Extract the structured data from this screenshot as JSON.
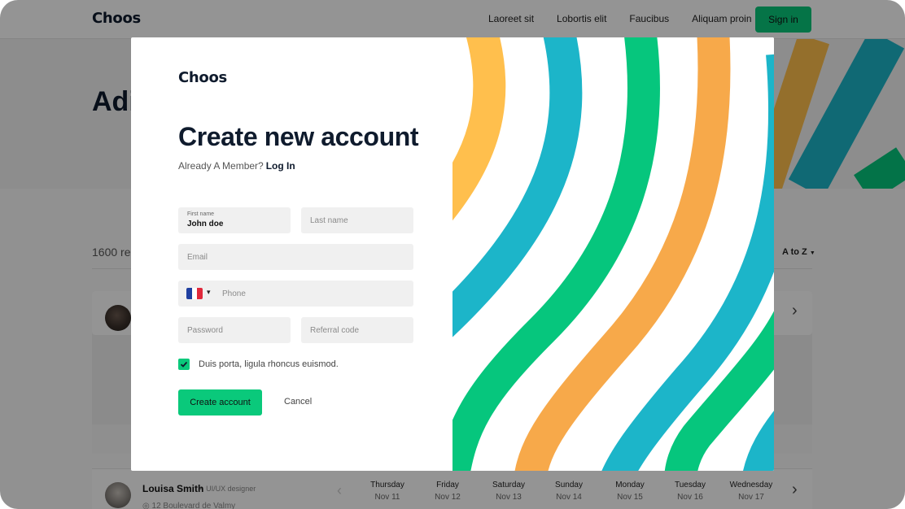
{
  "brand": {
    "name": "Choos",
    "accent": "#0ac97b",
    "dark": "#0f1b2d"
  },
  "nav": {
    "links": [
      "Laoreet sit",
      "Lobortis elit",
      "Faucibus",
      "Aliquam proin"
    ],
    "signin_label": "Sign in"
  },
  "hero": {
    "title_fragment": "Adi"
  },
  "results": {
    "count_fragment": "1600 re",
    "sort_label": "A to Z",
    "sort_icon": "caret-down-icon"
  },
  "listing": {
    "person": {
      "name": "Louisa Smith",
      "separator": "•",
      "role": "UI/UX designer",
      "address_fragment": "12 Boulevard de Valmy"
    },
    "days": [
      {
        "day": "Thursday",
        "date": "Nov 11"
      },
      {
        "day": "Friday",
        "date": "Nov 12"
      },
      {
        "day": "Saturday",
        "date": "Nov 13"
      },
      {
        "day": "Sunday",
        "date": "Nov 14"
      },
      {
        "day": "Monday",
        "date": "Nov 15"
      },
      {
        "day": "Tuesday",
        "date": "Nov 16"
      },
      {
        "day": "Wednesday",
        "date": "Nov 17"
      }
    ]
  },
  "modal": {
    "logo": "Choos",
    "title": "Create new account",
    "member_prompt": "Already A Member?",
    "login_link": "Log In",
    "first_name": {
      "label": "First name",
      "value": "John doe"
    },
    "last_name": {
      "placeholder": "Last name"
    },
    "email": {
      "placeholder": "Email"
    },
    "phone": {
      "placeholder": "Phone",
      "country_flag": "France",
      "flag_colors": [
        "#1f3fa0",
        "#ffffff",
        "#e0283b"
      ]
    },
    "password": {
      "placeholder": "Password"
    },
    "referral": {
      "placeholder": "Referral code"
    },
    "consent": {
      "checked": true,
      "label": "Duis porta, ligula rhoncus euismod."
    },
    "create_label": "Create account",
    "cancel_label": "Cancel"
  },
  "art_colors": [
    "#ffbf4d",
    "#1cb5c9",
    "#06c67d",
    "#f7a94a",
    "#69be5f"
  ]
}
